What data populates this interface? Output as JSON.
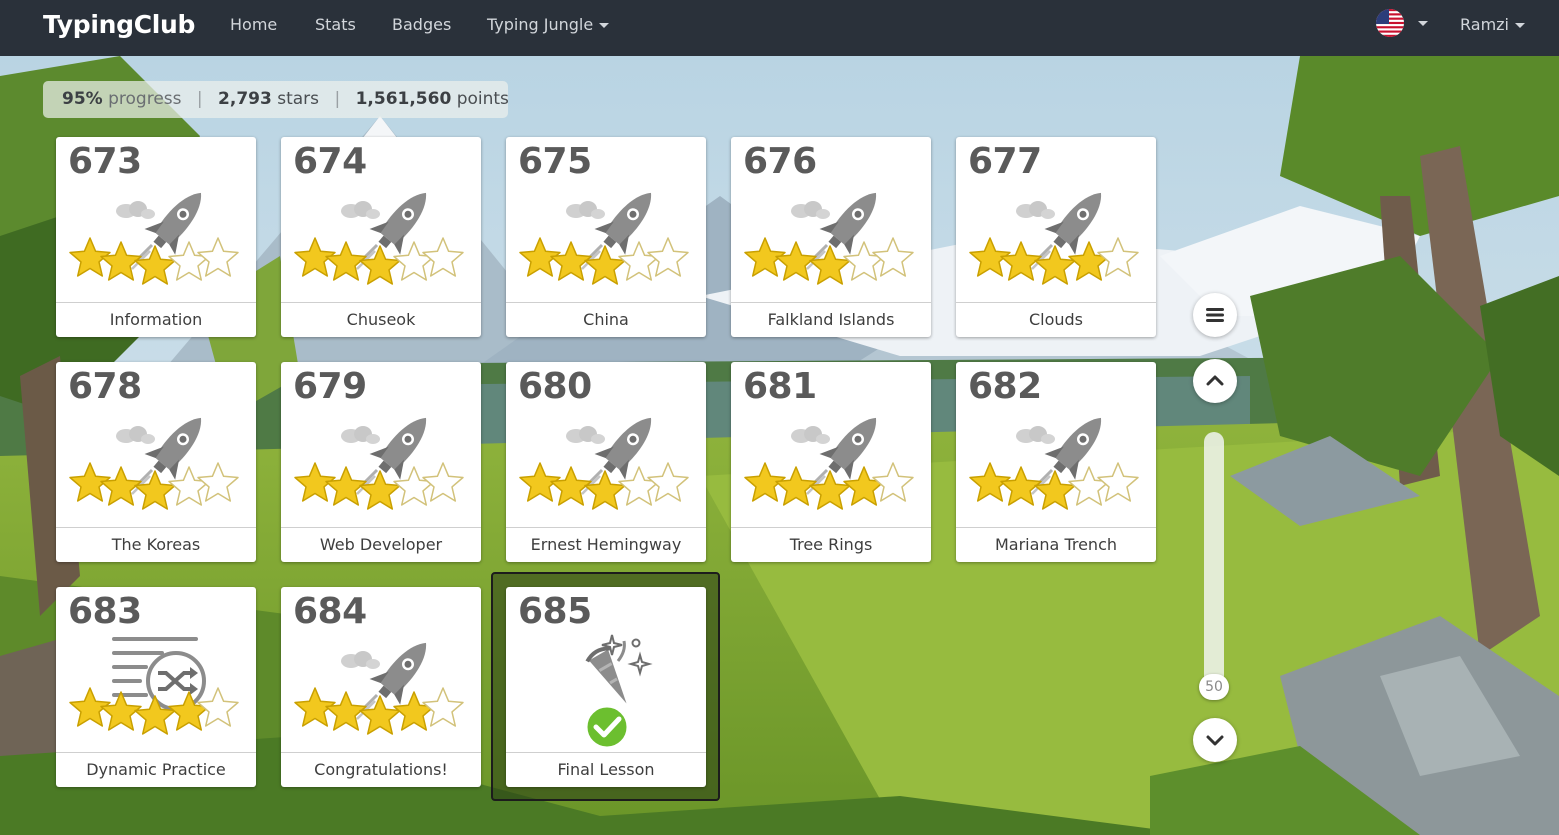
{
  "navbar": {
    "brand": "TypingClub",
    "links": [
      "Home",
      "Stats",
      "Badges"
    ],
    "dropdown_label": "Typing Jungle",
    "user_name": "Ramzi",
    "language_flag": "us-flag-icon"
  },
  "stats": {
    "progress_value": "95%",
    "progress_label": "progress",
    "stars_value": "2,793",
    "stars_label": "stars",
    "points_value": "1,561,560",
    "points_label": "points"
  },
  "lessons": [
    {
      "number": "673",
      "title": "Information",
      "icon": "rocket-icon",
      "stars": 3
    },
    {
      "number": "674",
      "title": "Chuseok",
      "icon": "rocket-icon",
      "stars": 3
    },
    {
      "number": "675",
      "title": "China",
      "icon": "rocket-icon",
      "stars": 3
    },
    {
      "number": "676",
      "title": "Falkland Islands",
      "icon": "rocket-icon",
      "stars": 3
    },
    {
      "number": "677",
      "title": "Clouds",
      "icon": "rocket-icon",
      "stars": 4
    },
    {
      "number": "678",
      "title": "The Koreas",
      "icon": "rocket-icon",
      "stars": 3
    },
    {
      "number": "679",
      "title": "Web Developer",
      "icon": "rocket-icon",
      "stars": 3
    },
    {
      "number": "680",
      "title": "Ernest Hemingway",
      "icon": "rocket-icon",
      "stars": 3
    },
    {
      "number": "681",
      "title": "Tree Rings",
      "icon": "rocket-icon",
      "stars": 4
    },
    {
      "number": "682",
      "title": "Mariana Trench",
      "icon": "rocket-icon",
      "stars": 3
    },
    {
      "number": "683",
      "title": "Dynamic Practice",
      "icon": "shuffle-practice-icon",
      "stars": 4
    },
    {
      "number": "684",
      "title": "Congratulations!",
      "icon": "rocket-icon",
      "stars": 4
    },
    {
      "number": "685",
      "title": "Final Lesson",
      "icon": "party-popper-icon",
      "completed": true,
      "current": true
    }
  ],
  "side_controls": {
    "menu_icon": "hamburger-menu-icon",
    "up_icon": "chevron-up-icon",
    "down_icon": "chevron-down-icon",
    "slider_value": "50"
  },
  "colors": {
    "navbar": "#2a313a",
    "star_filled": "#f2c81e",
    "star_empty": "#ffffff",
    "check_green": "#6cbf2f",
    "icon_gray": "#8c8c8c"
  }
}
